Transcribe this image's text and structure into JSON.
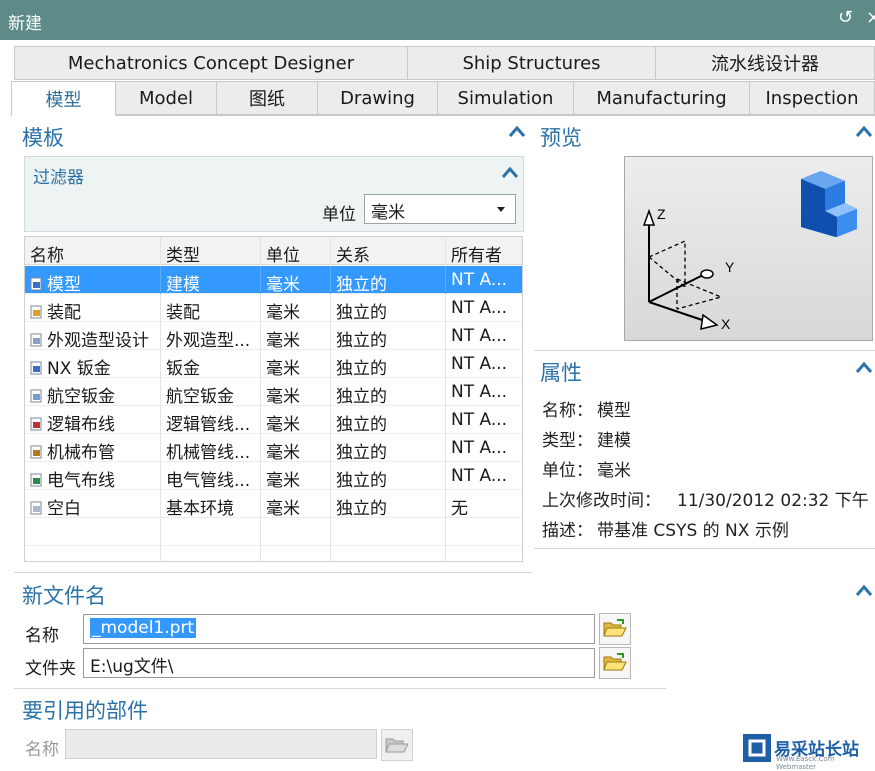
{
  "window": {
    "title": "新建",
    "reset_glyph": "↺",
    "close_glyph": "×"
  },
  "tabs": {
    "row1": [
      "Mechatronics Concept Designer",
      "Ship Structures",
      "流水线设计器"
    ],
    "row2": [
      "模型",
      "Model",
      "图纸",
      "Drawing",
      "Simulation",
      "Manufacturing",
      "Inspection"
    ],
    "active": "模型"
  },
  "templates": {
    "title": "模板",
    "filter": {
      "title": "过滤器",
      "unit_label": "单位",
      "unit_value": "毫米"
    },
    "columns": [
      "名称",
      "类型",
      "单位",
      "关系",
      "所有者"
    ],
    "rows": [
      {
        "name": "模型",
        "type": "建模",
        "unit": "毫米",
        "relation": "独立的",
        "owner": "NT A...",
        "icon": "model-icon",
        "selected": true
      },
      {
        "name": "装配",
        "type": "装配",
        "unit": "毫米",
        "relation": "独立的",
        "owner": "NT A...",
        "icon": "assembly-icon"
      },
      {
        "name": "外观造型设计",
        "type": "外观造型...",
        "unit": "毫米",
        "relation": "独立的",
        "owner": "NT A...",
        "icon": "shape-design-icon"
      },
      {
        "name": "NX 钣金",
        "type": "钣金",
        "unit": "毫米",
        "relation": "独立的",
        "owner": "NT A...",
        "icon": "sheet-metal-icon"
      },
      {
        "name": "航空钣金",
        "type": "航空钣金",
        "unit": "毫米",
        "relation": "独立的",
        "owner": "NT A...",
        "icon": "aero-sheet-metal-icon"
      },
      {
        "name": "逻辑布线",
        "type": "逻辑管线...",
        "unit": "毫米",
        "relation": "独立的",
        "owner": "NT A...",
        "icon": "logical-routing-icon"
      },
      {
        "name": "机械布管",
        "type": "机械管线...",
        "unit": "毫米",
        "relation": "独立的",
        "owner": "NT A...",
        "icon": "mechanical-piping-icon"
      },
      {
        "name": "电气布线",
        "type": "电气管线...",
        "unit": "毫米",
        "relation": "独立的",
        "owner": "NT A...",
        "icon": "electrical-routing-icon"
      },
      {
        "name": "空白",
        "type": "基本环境",
        "unit": "毫米",
        "relation": "独立的",
        "owner": "无",
        "icon": "blank-icon"
      }
    ]
  },
  "preview": {
    "title": "预览",
    "axis_labels": [
      "Z",
      "Y",
      "X"
    ]
  },
  "properties": {
    "title": "属性",
    "items": [
      {
        "key": "名称：",
        "value": "模型"
      },
      {
        "key": "类型：",
        "value": "建模"
      },
      {
        "key": "单位：",
        "value": "毫米"
      },
      {
        "key": "上次修改时间：",
        "value": "11/30/2012 02:32 下午"
      },
      {
        "key": "描述：",
        "value": "带基准 CSYS 的 NX 示例"
      }
    ]
  },
  "new_file": {
    "title": "新文件名",
    "name_label": "名称",
    "name_value": "_model1.prt",
    "folder_label": "文件夹",
    "folder_value": "E:\\ug文件\\"
  },
  "reference": {
    "title": "要引用的部件",
    "name_label": "名称",
    "name_value": ""
  },
  "watermark": {
    "text": "易采站长站",
    "sub": "Www.Easck.Com  Webmaster"
  },
  "colors": {
    "titlebar": "#5e8a87",
    "accent": "#2b72a8",
    "selection": "#3399ff"
  }
}
